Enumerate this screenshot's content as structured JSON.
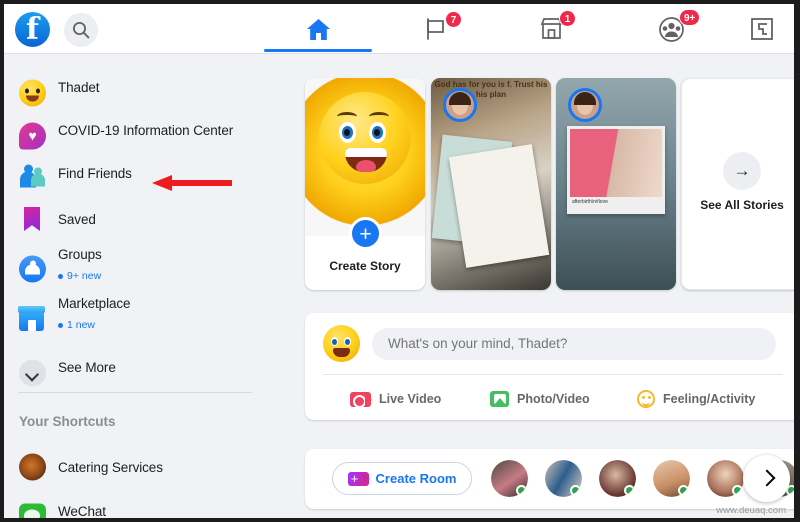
{
  "header": {
    "logo_icon": "facebook-logo-icon",
    "logo_glyph": "f",
    "search_icon": "search-icon",
    "tabs": [
      {
        "name": "home",
        "icon": "home-icon",
        "active": true,
        "badge": ""
      },
      {
        "name": "flag",
        "icon": "flag-icon",
        "active": false,
        "badge": "7"
      },
      {
        "name": "marketplace",
        "icon": "marketplace-icon",
        "active": false,
        "badge": "1"
      },
      {
        "name": "groups",
        "icon": "groups-icon",
        "active": false,
        "badge": "9+"
      },
      {
        "name": "gaming",
        "icon": "gaming-icon",
        "active": false,
        "badge": ""
      }
    ]
  },
  "sidebar": {
    "items": [
      {
        "label": "Thadet",
        "icon": "profile-emoji-avatar-icon",
        "sub": ""
      },
      {
        "label": "COVID-19 Information Center",
        "icon": "covid-heart-icon",
        "sub": ""
      },
      {
        "label": "Find Friends",
        "icon": "find-friends-icon",
        "sub": ""
      },
      {
        "label": "Saved",
        "icon": "bookmark-icon",
        "sub": ""
      },
      {
        "label": "Groups",
        "icon": "groups-circle-icon",
        "sub": "9+ new"
      },
      {
        "label": "Marketplace",
        "icon": "marketplace-store-icon",
        "sub": "1 new"
      },
      {
        "label": "See More",
        "icon": "chevron-down-icon",
        "sub": ""
      }
    ],
    "shortcuts_header": "Your Shortcuts",
    "shortcuts": [
      {
        "label": "Catering Services",
        "icon": "catering-thumbnail-icon"
      },
      {
        "label": "WeChat",
        "icon": "wechat-icon"
      }
    ]
  },
  "annotation": {
    "arrow_color": "#ee1c1c",
    "points_at": "Find Friends"
  },
  "stories": {
    "create": {
      "label": "Create Story",
      "plus_icon": "plus-icon"
    },
    "cards": [
      {
        "name": "story-1",
        "overlay_text": "God has for you is f. Trust his his plan"
      },
      {
        "name": "story-2",
        "caption": "afterbirth\\n#love"
      }
    ],
    "see_all": {
      "label": "See All Stories",
      "icon": "arrow-right-icon"
    }
  },
  "composer": {
    "placeholder": "What's on your mind, Thadet?",
    "avatar_icon": "profile-emoji-avatar-icon",
    "actions": [
      {
        "label": "Live Video",
        "icon": "live-video-icon",
        "color": "#f3425f"
      },
      {
        "label": "Photo/Video",
        "icon": "photo-video-icon",
        "color": "#45bd62"
      },
      {
        "label": "Feeling/Activity",
        "icon": "feeling-activity-icon",
        "color": "#f7b928"
      }
    ]
  },
  "rooms": {
    "create_label": "Create Room",
    "create_icon": "video-room-icon",
    "next_icon": "chevron-right-icon",
    "contacts": [
      {
        "name": "contact-1"
      },
      {
        "name": "contact-2"
      },
      {
        "name": "contact-3"
      },
      {
        "name": "contact-4"
      },
      {
        "name": "contact-5"
      },
      {
        "name": "contact-6"
      }
    ]
  },
  "watermark": "www.deuaq.com",
  "colors": {
    "brand_blue": "#1877f2",
    "badge_red": "#f02849",
    "page_bg": "#f0f2f5",
    "online_green": "#31a24c"
  }
}
